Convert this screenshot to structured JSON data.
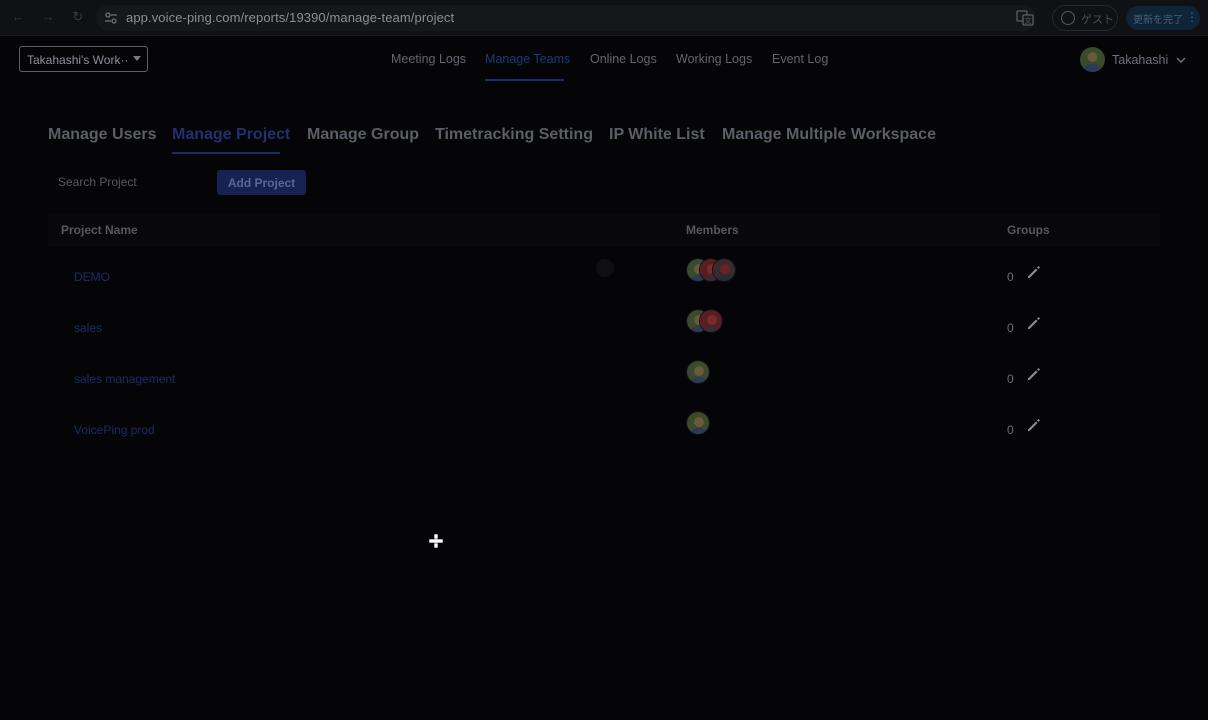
{
  "browser": {
    "url": "app.voice-ping.com/reports/19390/manage-team/project",
    "guest_label": "ゲスト",
    "update_label": "更新を完了"
  },
  "header": {
    "workspace": "Takahashi's Work···",
    "nav": [
      "Meeting Logs",
      "Manage Teams",
      "Online Logs",
      "Working Logs",
      "Event Log"
    ],
    "active_nav": "Manage Teams",
    "user_name": "Takahashi"
  },
  "subtabs": [
    "Manage Users",
    "Manage Project",
    "Manage Group",
    "Timetracking Setting",
    "IP White List",
    "Manage Multiple Workspace"
  ],
  "active_subtab": "Manage Project",
  "search": {
    "placeholder": "Search Project"
  },
  "add_button": "Add Project",
  "table": {
    "headers": {
      "name": "Project Name",
      "members": "Members",
      "groups": "Groups"
    },
    "rows": [
      {
        "name": "DEMO",
        "member_count": 3,
        "groups": "0"
      },
      {
        "name": "sales",
        "member_count": 2,
        "groups": "0"
      },
      {
        "name": "sales management",
        "member_count": 1,
        "groups": "0"
      },
      {
        "name": "VoicePing prod",
        "member_count": 1,
        "groups": "0"
      }
    ]
  },
  "colors": {
    "accent": "#1a3a78",
    "background": "#050507"
  }
}
